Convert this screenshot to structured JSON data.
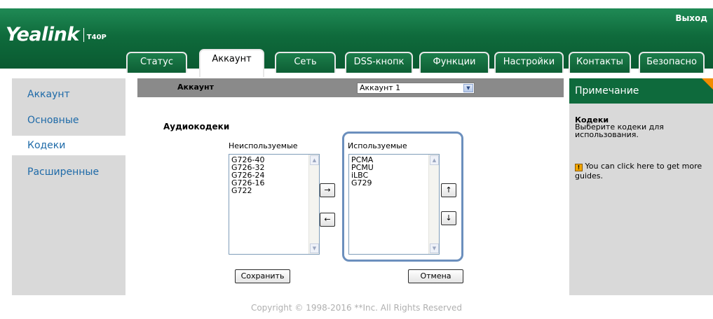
{
  "header": {
    "logo": "Yealink",
    "model": "T40P",
    "exit_label": "Выход"
  },
  "tabs": [
    {
      "label": "Статус",
      "active": false
    },
    {
      "label": "Аккаунт",
      "active": true
    },
    {
      "label": "Сеть",
      "active": false
    },
    {
      "label": "DSS-кнопк",
      "active": false
    },
    {
      "label": "Функции",
      "active": false
    },
    {
      "label": "Настройки",
      "active": false
    },
    {
      "label": "Контакты",
      "active": false
    },
    {
      "label": "Безопасно",
      "active": false
    }
  ],
  "sidebar": {
    "items": [
      {
        "label": "Аккаунт",
        "active": false
      },
      {
        "label": "Основные",
        "active": false
      },
      {
        "label": "Кодеки",
        "active": true
      },
      {
        "label": "Расширенные",
        "active": false
      }
    ]
  },
  "account_bar": {
    "label": "Аккаунт",
    "selected": "Аккаунт 1"
  },
  "codecs": {
    "title": "Аудиокодеки",
    "unused_label": "Неиспользуемые",
    "used_label": "Используемые",
    "unused": [
      "G726-40",
      "G726-32",
      "G726-24",
      "G726-16",
      "G722"
    ],
    "used": [
      "PCMA",
      "PCMU",
      "iLBC",
      "G729"
    ],
    "move_right": "→",
    "move_left": "←",
    "move_up": "↑",
    "move_down": "↓"
  },
  "actions": {
    "save": "Сохранить",
    "cancel": "Отмена"
  },
  "note": {
    "header": "Примечание",
    "title": "Кодеки",
    "text": "Выберите кодеки для использования.",
    "guide": "You can click here to get more guides."
  },
  "footer": "Copyright © 1998-2016 **Inc. All Rights Reserved",
  "colors": {
    "header_green": "#0f6b3c",
    "link_blue": "#1e6aa8",
    "highlight_blue": "#6b8fbd",
    "accent_orange": "#f28c00"
  }
}
